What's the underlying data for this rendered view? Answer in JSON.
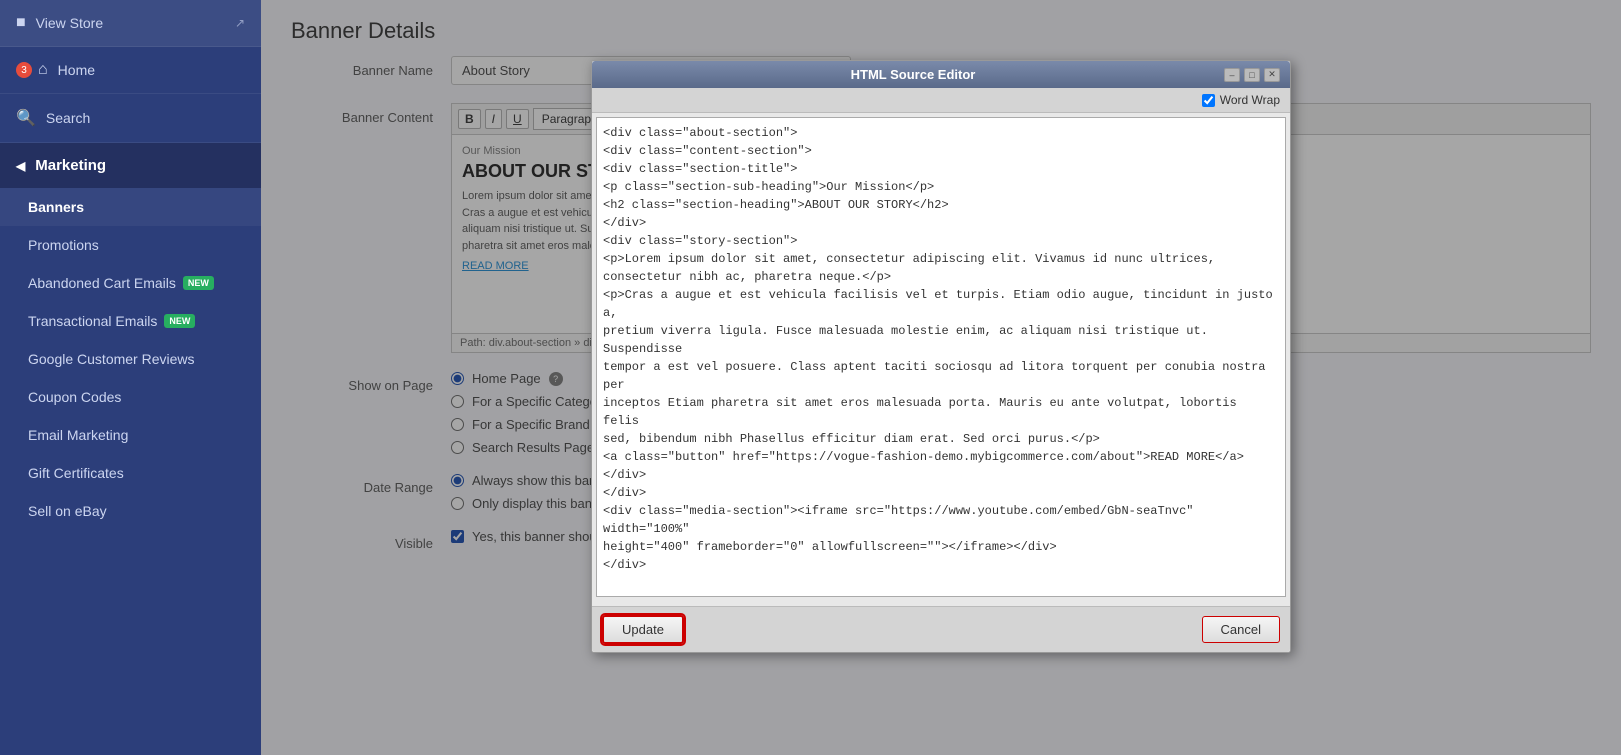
{
  "sidebar": {
    "view_store_label": "View Store",
    "home_label": "Home",
    "home_badge": "3",
    "search_label": "Search",
    "marketing_label": "Marketing",
    "nav_items": [
      {
        "id": "banners",
        "label": "Banners",
        "active": true,
        "new": false
      },
      {
        "id": "promotions",
        "label": "Promotions",
        "active": false,
        "new": false
      },
      {
        "id": "abandoned-cart",
        "label": "Abandoned Cart Emails",
        "active": false,
        "new": true
      },
      {
        "id": "transactional-emails",
        "label": "Transactional Emails",
        "active": false,
        "new": true
      },
      {
        "id": "google-customer-reviews",
        "label": "Google Customer Reviews",
        "active": false,
        "new": false
      },
      {
        "id": "coupon-codes",
        "label": "Coupon Codes",
        "active": false,
        "new": false
      },
      {
        "id": "email-marketing",
        "label": "Email Marketing",
        "active": false,
        "new": false
      },
      {
        "id": "gift-certificates",
        "label": "Gift Certificates",
        "active": false,
        "new": false
      },
      {
        "id": "sell-on-ebay",
        "label": "Sell on eBay",
        "active": false,
        "new": false
      }
    ]
  },
  "page": {
    "title": "Banner Details"
  },
  "form": {
    "banner_name_label": "Banner Name",
    "banner_name_value": "About Story",
    "banner_content_label": "Banner Content",
    "toolbar_buttons": [
      "cut",
      "copy",
      "paste",
      "pastetext",
      "undo",
      "redo",
      "bold",
      "italic",
      "underline",
      "paragraph"
    ],
    "editor_content": {
      "mission": "Our Mission",
      "heading": "ABOUT OUR STORY",
      "lorem1": "Lorem ipsum dolor sit amet, con",
      "lorem2": "Cras a augue et est vehicula faci",
      "lorem3": "aliquam nisi tristique ut. Suspend",
      "lorem4": "pharetra sit amet eros malesuad",
      "read_more": "READ MORE"
    },
    "path": "Path: div.about-section » div.con",
    "show_on_page_label": "Show on Page",
    "radio_options": [
      {
        "id": "home-page",
        "label": "Home Page",
        "checked": true
      },
      {
        "id": "specific-category",
        "label": "For a Specific Category",
        "checked": false
      },
      {
        "id": "specific-brand",
        "label": "For a Specific Brand",
        "checked": false
      },
      {
        "id": "search-results",
        "label": "Search Results Page",
        "checked": false
      }
    ],
    "date_range_label": "Date Range",
    "date_radio_options": [
      {
        "id": "always-show",
        "label": "Always show this ban",
        "checked": true
      },
      {
        "id": "only-display",
        "label": "Only display this ban",
        "checked": false
      }
    ],
    "visible_label": "Visible",
    "visible_checkbox_label": "Yes, this banner should be visible on my web site",
    "visible_checked": true
  },
  "modal": {
    "title": "HTML Source Editor",
    "word_wrap_label": "Word Wrap",
    "word_wrap_checked": true,
    "html_content": "<div class=\"about-section\">\n<div class=\"content-section\">\n<div class=\"section-title\">\n<p class=\"section-sub-heading\">Our Mission</p>\n<h2 class=\"section-heading\">ABOUT OUR STORY</h2>\n</div>\n<div class=\"story-section\">\n<p>Lorem ipsum dolor sit amet, consectetur adipiscing elit. Vivamus id nunc ultrices,\nconsectetur nibh ac, pharetra neque.</p>\n<p>Cras a augue et est vehicula facilisis vel et turpis. Etiam odio augue, tincidunt in justo a,\npretium viverra ligula. Fusce malesuada molestie enim, ac aliquam nisi tristique ut. Suspendisse\ntempor a est vel posuere. Class aptent taciti sociosqu ad litora torquent per conubia nostra per\ninceptos Etiam pharetra sit amet eros malesuada porta. Mauris eu ante volutpat, lobortis felis\nsed, bibendum nibh Phasellus efficitur diam erat. Sed orci purus.</p>\n<a class=\"button\" href=\"https://vogue-fashion-demo.mybigcommerce.com/about\">READ MORE</a></div>\n</div>\n<div class=\"media-section\"><iframe src=\"https://www.youtube.com/embed/GbN-seaTnvc\" width=\"100%\"\nheight=\"400\" frameborder=\"0\" allowfullscreen=\"\"></iframe></div>\n</div>",
    "update_label": "Update",
    "cancel_label": "Cancel"
  }
}
